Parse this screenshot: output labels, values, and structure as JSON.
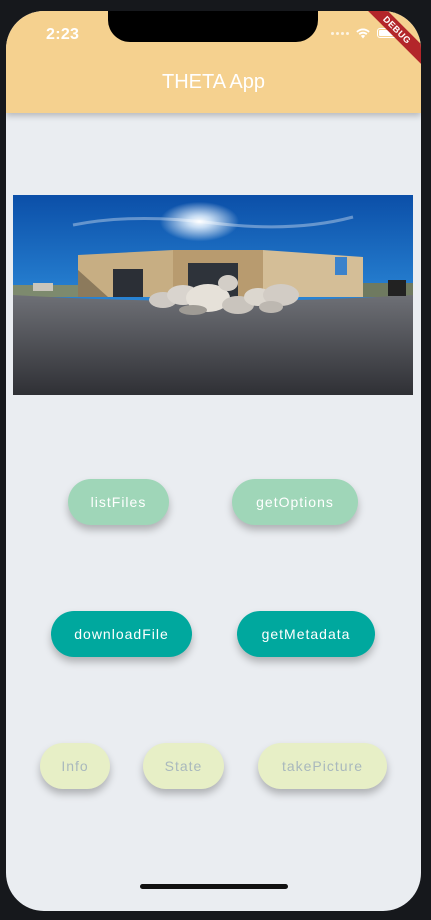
{
  "status_bar": {
    "time": "2:23",
    "debug_label": "DEBUG"
  },
  "app_bar": {
    "title": "THETA App",
    "color": "#f5d18f"
  },
  "image": {
    "icon": "panorama-image"
  },
  "buttons": {
    "row1": [
      {
        "label": "listFiles",
        "color": "#9fd6b8"
      },
      {
        "label": "getOptions",
        "color": "#9fd6b8"
      }
    ],
    "row2": [
      {
        "label": "downloadFile",
        "color": "#00a89e"
      },
      {
        "label": "getMetadata",
        "color": "#00a89e"
      }
    ],
    "row3": [
      {
        "label": "Info",
        "color": "#e7efc6"
      },
      {
        "label": "State",
        "color": "#e7efc6"
      },
      {
        "label": "takePicture",
        "color": "#e7efc6"
      }
    ]
  }
}
